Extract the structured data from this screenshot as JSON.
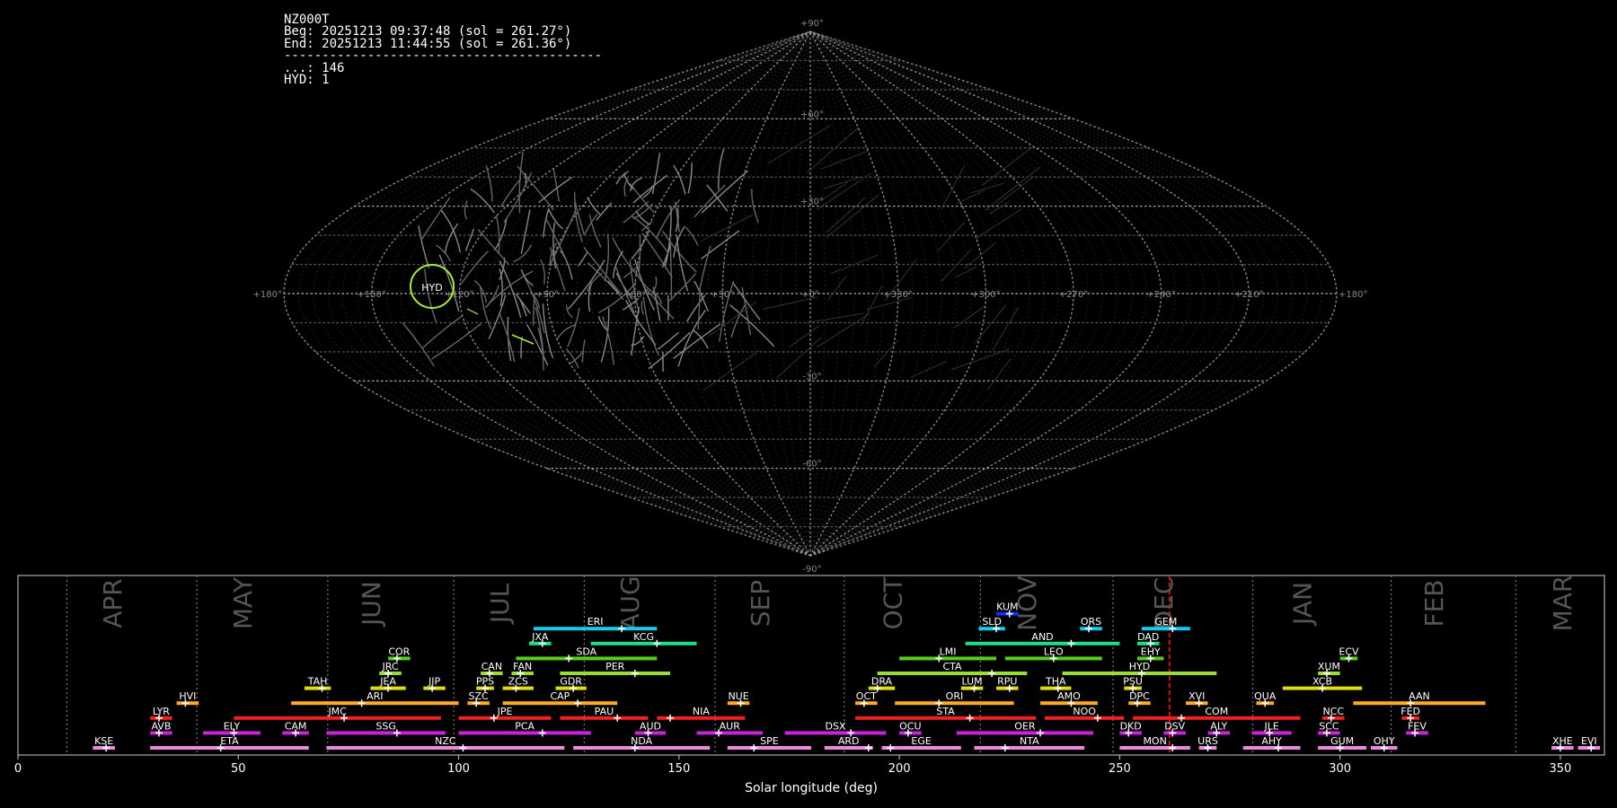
{
  "info": {
    "station": "NZ000T",
    "beg": "Beg: 20251213 09:37:48 (sol = 261.27°)",
    "end": "End: 20251213 11:44:55 (sol = 261.36°)",
    "separator": "------------------------------------------",
    "counts": [
      {
        "code": "...",
        "count": 146
      },
      {
        "code": "HYD",
        "count": 1
      }
    ]
  },
  "sky_map": {
    "projection": "sinusoidal",
    "lon_ticks": [
      "+180°",
      "+150°",
      "+120°",
      "+90°",
      "+60°",
      "+30°",
      "+0°",
      "+330°",
      "+300°",
      "+270°",
      "+240°",
      "+210°",
      "+180°"
    ],
    "lat_ticks": [
      "+90°",
      "+60°",
      "+30°",
      "-30°",
      "-60°",
      "-90°"
    ],
    "highlight": {
      "label": "HYD",
      "color": "#aaee33"
    }
  },
  "chart_data": {
    "type": "bar",
    "title": "",
    "xlabel": "Solar longitude (deg)",
    "xlim": [
      0,
      360
    ],
    "xticks": [
      0,
      50,
      100,
      150,
      200,
      250,
      300,
      350
    ],
    "current_sol": 261.3,
    "months": [
      {
        "name": "APR",
        "start": 11.1
      },
      {
        "name": "MAY",
        "start": 40.6
      },
      {
        "name": "JUN",
        "start": 70.3
      },
      {
        "name": "JUL",
        "start": 98.9
      },
      {
        "name": "AUG",
        "start": 128.5
      },
      {
        "name": "SEP",
        "start": 158.2
      },
      {
        "name": "OCT",
        "start": 187.5
      },
      {
        "name": "NOV",
        "start": 218.4
      },
      {
        "name": "DEC",
        "start": 248.5
      },
      {
        "name": "JAN",
        "start": 280.2
      },
      {
        "name": "FEB",
        "start": 311.6
      },
      {
        "name": "MAR",
        "start": 339.9
      }
    ],
    "showers": [
      {
        "code": "KUM",
        "start": 222,
        "end": 227,
        "peak": 225,
        "row": 10,
        "color": "#1133ee"
      },
      {
        "code": "ERI",
        "start": 117,
        "end": 145,
        "peak": 137,
        "row": 9,
        "color": "#11ccee"
      },
      {
        "code": "SLD",
        "start": 218,
        "end": 224,
        "peak": 222,
        "row": 9,
        "color": "#11ccee"
      },
      {
        "code": "ORS",
        "start": 241,
        "end": 246,
        "peak": 243,
        "row": 9,
        "color": "#11ccee"
      },
      {
        "code": "GEM",
        "start": 255,
        "end": 266,
        "peak": 262,
        "row": 9,
        "color": "#11ccee"
      },
      {
        "code": "JXA",
        "start": 116,
        "end": 121,
        "peak": 119,
        "row": 8,
        "color": "#22dd88"
      },
      {
        "code": "KCG",
        "start": 130,
        "end": 154,
        "peak": 145,
        "row": 8,
        "color": "#22dd88"
      },
      {
        "code": "AND",
        "start": 215,
        "end": 250,
        "peak": 239,
        "row": 8,
        "color": "#22dd88"
      },
      {
        "code": "DAD",
        "start": 254,
        "end": 259,
        "peak": 257,
        "row": 8,
        "color": "#22dd88"
      },
      {
        "code": "COR",
        "start": 84,
        "end": 89,
        "peak": 86,
        "row": 7,
        "color": "#55cc22"
      },
      {
        "code": "SDA",
        "start": 113,
        "end": 145,
        "peak": 125,
        "row": 7,
        "color": "#55cc22"
      },
      {
        "code": "LMI",
        "start": 200,
        "end": 222,
        "peak": 209,
        "row": 7,
        "color": "#55cc22"
      },
      {
        "code": "LEO",
        "start": 224,
        "end": 246,
        "peak": 235,
        "row": 7,
        "color": "#55cc22"
      },
      {
        "code": "EHY",
        "start": 254,
        "end": 260,
        "peak": 257,
        "row": 7,
        "color": "#55cc22"
      },
      {
        "code": "ECV",
        "start": 300,
        "end": 304,
        "peak": 302,
        "row": 7,
        "color": "#55cc22"
      },
      {
        "code": "JRC",
        "start": 82,
        "end": 87,
        "peak": 84,
        "row": 6,
        "color": "#99dd33"
      },
      {
        "code": "CAN",
        "start": 105,
        "end": 110,
        "peak": 107,
        "row": 6,
        "color": "#99dd33"
      },
      {
        "code": "FAN",
        "start": 112,
        "end": 117,
        "peak": 114,
        "row": 6,
        "color": "#99dd33"
      },
      {
        "code": "PER",
        "start": 123,
        "end": 148,
        "peak": 140,
        "row": 6,
        "color": "#99dd33"
      },
      {
        "code": "CTA",
        "start": 195,
        "end": 229,
        "peak": 221,
        "row": 6,
        "color": "#99dd33"
      },
      {
        "code": "HYD",
        "start": 237,
        "end": 272,
        "peak": 255,
        "row": 6,
        "color": "#99dd33"
      },
      {
        "code": "XUM",
        "start": 295,
        "end": 300,
        "peak": 297,
        "row": 6,
        "color": "#99dd33"
      },
      {
        "code": "TAH",
        "start": 65,
        "end": 71,
        "peak": 69,
        "row": 5,
        "color": "#dddd11"
      },
      {
        "code": "JEA",
        "start": 80,
        "end": 88,
        "peak": 84,
        "row": 5,
        "color": "#dddd11"
      },
      {
        "code": "JIP",
        "start": 92,
        "end": 97,
        "peak": 94,
        "row": 5,
        "color": "#dddd11"
      },
      {
        "code": "PPS",
        "start": 104,
        "end": 108,
        "peak": 106,
        "row": 5,
        "color": "#dddd11"
      },
      {
        "code": "ZCS",
        "start": 110,
        "end": 117,
        "peak": 113,
        "row": 5,
        "color": "#dddd11"
      },
      {
        "code": "GDR",
        "start": 122,
        "end": 129,
        "peak": 126,
        "row": 5,
        "color": "#dddd11"
      },
      {
        "code": "DRA",
        "start": 193,
        "end": 199,
        "peak": 195,
        "row": 5,
        "color": "#dddd11"
      },
      {
        "code": "LUM",
        "start": 214,
        "end": 219,
        "peak": 217,
        "row": 5,
        "color": "#dddd11"
      },
      {
        "code": "RPU",
        "start": 222,
        "end": 227,
        "peak": 225,
        "row": 5,
        "color": "#dddd11"
      },
      {
        "code": "THA",
        "start": 232,
        "end": 239,
        "peak": 236,
        "row": 5,
        "color": "#dddd11"
      },
      {
        "code": "PSU",
        "start": 251,
        "end": 255,
        "peak": 253,
        "row": 5,
        "color": "#dddd11"
      },
      {
        "code": "XCB",
        "start": 287,
        "end": 305,
        "peak": 296,
        "row": 5,
        "color": "#dddd11"
      },
      {
        "code": "HVI",
        "start": 36,
        "end": 41,
        "peak": 38,
        "row": 4,
        "color": "#ffaa22"
      },
      {
        "code": "ARI",
        "start": 62,
        "end": 100,
        "peak": 78,
        "row": 4,
        "color": "#ffaa22"
      },
      {
        "code": "SZC",
        "start": 102,
        "end": 107,
        "peak": 104,
        "row": 4,
        "color": "#ffaa22"
      },
      {
        "code": "CAP",
        "start": 110,
        "end": 136,
        "peak": 127,
        "row": 4,
        "color": "#ffaa22"
      },
      {
        "code": "NUE",
        "start": 161,
        "end": 166,
        "peak": 164,
        "row": 4,
        "color": "#ffaa22"
      },
      {
        "code": "OCT",
        "start": 190,
        "end": 195,
        "peak": 192,
        "row": 4,
        "color": "#ffaa22"
      },
      {
        "code": "ORI",
        "start": 199,
        "end": 226,
        "peak": 209,
        "row": 4,
        "color": "#ffaa22"
      },
      {
        "code": "AMO",
        "start": 232,
        "end": 245,
        "peak": 239,
        "row": 4,
        "color": "#ffaa22"
      },
      {
        "code": "DPC",
        "start": 252,
        "end": 257,
        "peak": 254,
        "row": 4,
        "color": "#ffaa22"
      },
      {
        "code": "XVI",
        "start": 265,
        "end": 270,
        "peak": 268,
        "row": 4,
        "color": "#ffaa22"
      },
      {
        "code": "QUA",
        "start": 281,
        "end": 285,
        "peak": 283,
        "row": 4,
        "color": "#ffaa22"
      },
      {
        "code": "AAN",
        "start": 303,
        "end": 333,
        "peak": 316,
        "row": 4,
        "color": "#ffaa22"
      },
      {
        "code": "LYR",
        "start": 30,
        "end": 35,
        "peak": 32,
        "row": 3,
        "color": "#ee2222"
      },
      {
        "code": "JMC",
        "start": 49,
        "end": 96,
        "peak": 74,
        "row": 3,
        "color": "#ee2222"
      },
      {
        "code": "JPE",
        "start": 100,
        "end": 121,
        "peak": 108,
        "row": 3,
        "color": "#ee2222"
      },
      {
        "code": "PAU",
        "start": 123,
        "end": 143,
        "peak": 136,
        "row": 3,
        "color": "#ee2222"
      },
      {
        "code": "NIA",
        "start": 145,
        "end": 165,
        "peak": 148,
        "row": 3,
        "color": "#ee2222"
      },
      {
        "code": "STA",
        "start": 190,
        "end": 231,
        "peak": 216,
        "row": 3,
        "color": "#ee2222"
      },
      {
        "code": "NOO",
        "start": 233,
        "end": 251,
        "peak": 245,
        "row": 3,
        "color": "#ee2222"
      },
      {
        "code": "COM",
        "start": 253,
        "end": 291,
        "peak": 264,
        "row": 3,
        "color": "#ee2222"
      },
      {
        "code": "NCC",
        "start": 296,
        "end": 301,
        "peak": 298,
        "row": 3,
        "color": "#ee2222"
      },
      {
        "code": "FED",
        "start": 314,
        "end": 318,
        "peak": 316,
        "row": 3,
        "color": "#ee2222"
      },
      {
        "code": "AVB",
        "start": 30,
        "end": 35,
        "peak": 32,
        "row": 2,
        "color": "#cc22dd"
      },
      {
        "code": "ELY",
        "start": 42,
        "end": 55,
        "peak": 49,
        "row": 2,
        "color": "#cc22dd"
      },
      {
        "code": "CAM",
        "start": 60,
        "end": 66,
        "peak": 63,
        "row": 2,
        "color": "#cc22dd"
      },
      {
        "code": "SSG",
        "start": 70,
        "end": 97,
        "peak": 86,
        "row": 2,
        "color": "#cc22dd"
      },
      {
        "code": "PCA",
        "start": 100,
        "end": 130,
        "peak": 119,
        "row": 2,
        "color": "#cc22dd"
      },
      {
        "code": "AUD",
        "start": 140,
        "end": 147,
        "peak": 143,
        "row": 2,
        "color": "#cc22dd"
      },
      {
        "code": "AUR",
        "start": 154,
        "end": 169,
        "peak": 159,
        "row": 2,
        "color": "#cc22dd"
      },
      {
        "code": "DSX",
        "start": 174,
        "end": 197,
        "peak": 189,
        "row": 2,
        "color": "#cc22dd"
      },
      {
        "code": "OCU",
        "start": 200,
        "end": 205,
        "peak": 202,
        "row": 2,
        "color": "#cc22dd"
      },
      {
        "code": "OER",
        "start": 213,
        "end": 244,
        "peak": 232,
        "row": 2,
        "color": "#cc22dd"
      },
      {
        "code": "DKD",
        "start": 250,
        "end": 255,
        "peak": 252,
        "row": 2,
        "color": "#cc22dd"
      },
      {
        "code": "DSV",
        "start": 260,
        "end": 265,
        "peak": 262,
        "row": 2,
        "color": "#cc22dd"
      },
      {
        "code": "ALY",
        "start": 270,
        "end": 275,
        "peak": 272,
        "row": 2,
        "color": "#cc22dd"
      },
      {
        "code": "JLE",
        "start": 280,
        "end": 289,
        "peak": 284,
        "row": 2,
        "color": "#cc22dd"
      },
      {
        "code": "SCC",
        "start": 295,
        "end": 300,
        "peak": 297,
        "row": 2,
        "color": "#cc22dd"
      },
      {
        "code": "FEV",
        "start": 315,
        "end": 320,
        "peak": 317,
        "row": 2,
        "color": "#cc22dd"
      },
      {
        "code": "KSE",
        "start": 17,
        "end": 22,
        "peak": 20,
        "row": 1,
        "color": "#ee88dd"
      },
      {
        "code": "ETA",
        "start": 30,
        "end": 66,
        "peak": 46,
        "row": 1,
        "color": "#ee88dd"
      },
      {
        "code": "NZC",
        "start": 70,
        "end": 124,
        "peak": 101,
        "row": 1,
        "color": "#ee88dd"
      },
      {
        "code": "NDA",
        "start": 126,
        "end": 157,
        "peak": 140,
        "row": 1,
        "color": "#ee88dd"
      },
      {
        "code": "SPE",
        "start": 161,
        "end": 180,
        "peak": 167,
        "row": 1,
        "color": "#ee88dd"
      },
      {
        "code": "ARD",
        "start": 183,
        "end": 194,
        "peak": 193,
        "row": 1,
        "color": "#ee88dd"
      },
      {
        "code": "EGE",
        "start": 196,
        "end": 214,
        "peak": 198,
        "row": 1,
        "color": "#ee88dd"
      },
      {
        "code": "NTA",
        "start": 217,
        "end": 242,
        "peak": 224,
        "row": 1,
        "color": "#ee88dd"
      },
      {
        "code": "MON",
        "start": 250,
        "end": 266,
        "peak": 262,
        "row": 1,
        "color": "#ee88dd"
      },
      {
        "code": "URS",
        "start": 268,
        "end": 272,
        "peak": 270,
        "row": 1,
        "color": "#ee88dd"
      },
      {
        "code": "AHY",
        "start": 278,
        "end": 291,
        "peak": 286,
        "row": 1,
        "color": "#ee88dd"
      },
      {
        "code": "GUM",
        "start": 295,
        "end": 306,
        "peak": 300,
        "row": 1,
        "color": "#ee88dd"
      },
      {
        "code": "OHY",
        "start": 307,
        "end": 313,
        "peak": 310,
        "row": 1,
        "color": "#ee88dd"
      },
      {
        "code": "XHE",
        "start": 348,
        "end": 353,
        "peak": 350,
        "row": 1,
        "color": "#ee88dd"
      },
      {
        "code": "EVI",
        "start": 354,
        "end": 359,
        "peak": 357,
        "row": 1,
        "color": "#ee88dd"
      }
    ]
  }
}
